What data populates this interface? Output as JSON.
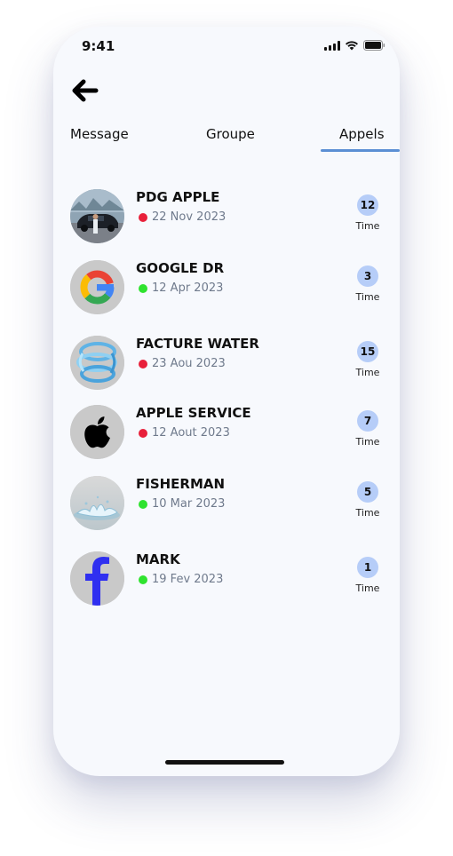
{
  "status_bar": {
    "time": "9:41"
  },
  "tabs": [
    {
      "label": "Message",
      "active": false
    },
    {
      "label": "Groupe",
      "active": false
    },
    {
      "label": "Appels",
      "active": true
    }
  ],
  "colors": {
    "accent": "#5b8fd4",
    "badge": "#b6cdf8",
    "status_missed": "#e8203a",
    "status_ok": "#2fe32f"
  },
  "calls": [
    {
      "name": "PDG APPLE",
      "date": "22 Nov 2023",
      "status": "missed",
      "count": "12",
      "count_label": "Time",
      "avatar": "photo-car"
    },
    {
      "name": "GOOGLE DR",
      "date": "12 Apr 2023",
      "status": "ok",
      "count": "3",
      "count_label": "Time",
      "avatar": "google-logo"
    },
    {
      "name": "FACTURE WATER",
      "date": "23 Aou 2023",
      "status": "missed",
      "count": "15",
      "count_label": "Time",
      "avatar": "water-swirl"
    },
    {
      "name": "APPLE SERVICE",
      "date": "12 Aout 2023",
      "status": "missed",
      "count": "7",
      "count_label": "Time",
      "avatar": "apple-logo"
    },
    {
      "name": "FISHERMAN",
      "date": "10 Mar 2023",
      "status": "ok",
      "count": "5",
      "count_label": "Time",
      "avatar": "water-splash"
    },
    {
      "name": "MARK",
      "date": "19 Fev 2023",
      "status": "ok",
      "count": "1",
      "count_label": "Time",
      "avatar": "facebook-logo"
    }
  ]
}
